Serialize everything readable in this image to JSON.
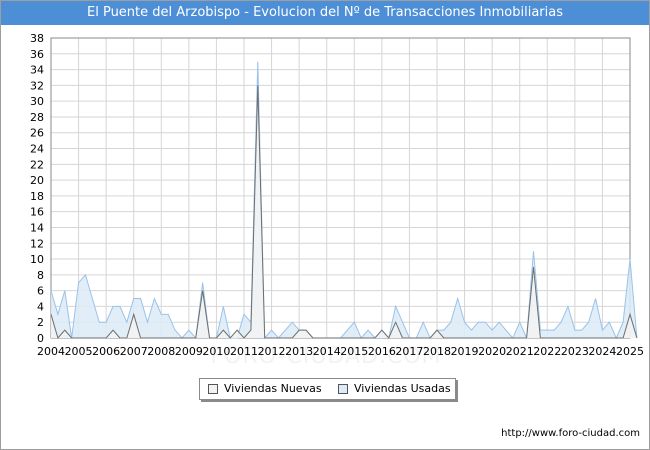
{
  "chart_data": {
    "type": "area",
    "title": "El Puente del Arzobispo - Evolucion del Nº de Transacciones Inmobiliarias",
    "xlabel": "",
    "ylabel": "",
    "ylim": [
      0,
      38
    ],
    "ytick_step": 2,
    "x_tick_labels": [
      "2004",
      "2005",
      "2006",
      "2007",
      "2008",
      "2009",
      "2010",
      "2011",
      "2012",
      "2013",
      "2014",
      "2015",
      "2016",
      "2017",
      "2018",
      "2019",
      "2020",
      "2021",
      "2022",
      "2023",
      "2024",
      "2025"
    ],
    "grid": true,
    "legend_position": "bottom-center",
    "quarters_per_year": 4,
    "series": [
      {
        "name": "Viviendas Usadas",
        "color": "#dcebf7",
        "stroke": "#99c2eb",
        "values": [
          6,
          3,
          6,
          0,
          7,
          8,
          5,
          2,
          2,
          4,
          4,
          2,
          5,
          5,
          2,
          5,
          3,
          3,
          1,
          0,
          1,
          0,
          7,
          0,
          0,
          4,
          0,
          0,
          3,
          2,
          35,
          0,
          1,
          0,
          1,
          2,
          1,
          1,
          0,
          0,
          0,
          0,
          0,
          1,
          2,
          0,
          1,
          0,
          1,
          0,
          4,
          2,
          0,
          0,
          2,
          0,
          1,
          1,
          2,
          5,
          2,
          1,
          2,
          2,
          1,
          2,
          1,
          0,
          2,
          0,
          11,
          1,
          1,
          1,
          2,
          4,
          1,
          1,
          2,
          5,
          1,
          2,
          0,
          2,
          10,
          0
        ]
      },
      {
        "name": "Viviendas Nuevas",
        "color": "#f2f2f2",
        "stroke": "#6e6e6e",
        "values": [
          3,
          0,
          1,
          0,
          0,
          0,
          0,
          0,
          0,
          1,
          0,
          0,
          3,
          0,
          0,
          0,
          0,
          0,
          0,
          0,
          0,
          0,
          6,
          0,
          0,
          1,
          0,
          1,
          0,
          1,
          32,
          0,
          0,
          0,
          0,
          0,
          1,
          1,
          0,
          0,
          0,
          0,
          0,
          0,
          0,
          0,
          0,
          0,
          1,
          0,
          2,
          0,
          0,
          0,
          0,
          0,
          1,
          0,
          0,
          0,
          0,
          0,
          0,
          0,
          0,
          0,
          0,
          0,
          0,
          0,
          9,
          0,
          0,
          0,
          0,
          0,
          0,
          0,
          0,
          0,
          0,
          0,
          0,
          0,
          3,
          0
        ]
      }
    ]
  },
  "legend": {
    "items": [
      {
        "label": "Viviendas Nuevas",
        "color": "#f2f2f2"
      },
      {
        "label": "Viviendas Usadas",
        "color": "#dcebf7"
      }
    ]
  },
  "footer": {
    "url": "http://www.foro-ciudad.com"
  },
  "watermark": "FORO-CIUDAD.COM"
}
